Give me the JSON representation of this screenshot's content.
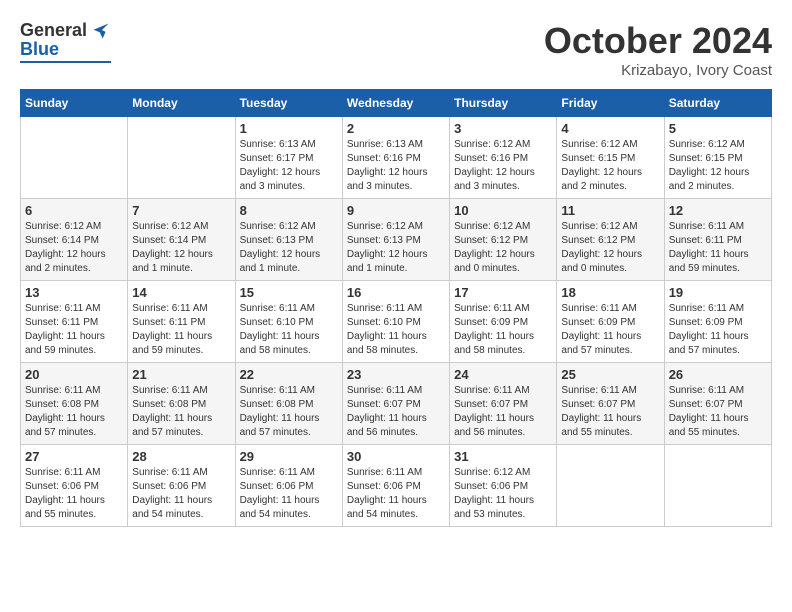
{
  "header": {
    "logo_general": "General",
    "logo_blue": "Blue",
    "month_title": "October 2024",
    "location": "Krizabayo, Ivory Coast"
  },
  "days_of_week": [
    "Sunday",
    "Monday",
    "Tuesday",
    "Wednesday",
    "Thursday",
    "Friday",
    "Saturday"
  ],
  "weeks": [
    [
      {
        "day": "",
        "info": ""
      },
      {
        "day": "",
        "info": ""
      },
      {
        "day": "1",
        "info": "Sunrise: 6:13 AM\nSunset: 6:17 PM\nDaylight: 12 hours and 3 minutes."
      },
      {
        "day": "2",
        "info": "Sunrise: 6:13 AM\nSunset: 6:16 PM\nDaylight: 12 hours and 3 minutes."
      },
      {
        "day": "3",
        "info": "Sunrise: 6:12 AM\nSunset: 6:16 PM\nDaylight: 12 hours and 3 minutes."
      },
      {
        "day": "4",
        "info": "Sunrise: 6:12 AM\nSunset: 6:15 PM\nDaylight: 12 hours and 2 minutes."
      },
      {
        "day": "5",
        "info": "Sunrise: 6:12 AM\nSunset: 6:15 PM\nDaylight: 12 hours and 2 minutes."
      }
    ],
    [
      {
        "day": "6",
        "info": "Sunrise: 6:12 AM\nSunset: 6:14 PM\nDaylight: 12 hours and 2 minutes."
      },
      {
        "day": "7",
        "info": "Sunrise: 6:12 AM\nSunset: 6:14 PM\nDaylight: 12 hours and 1 minute."
      },
      {
        "day": "8",
        "info": "Sunrise: 6:12 AM\nSunset: 6:13 PM\nDaylight: 12 hours and 1 minute."
      },
      {
        "day": "9",
        "info": "Sunrise: 6:12 AM\nSunset: 6:13 PM\nDaylight: 12 hours and 1 minute."
      },
      {
        "day": "10",
        "info": "Sunrise: 6:12 AM\nSunset: 6:12 PM\nDaylight: 12 hours and 0 minutes."
      },
      {
        "day": "11",
        "info": "Sunrise: 6:12 AM\nSunset: 6:12 PM\nDaylight: 12 hours and 0 minutes."
      },
      {
        "day": "12",
        "info": "Sunrise: 6:11 AM\nSunset: 6:11 PM\nDaylight: 11 hours and 59 minutes."
      }
    ],
    [
      {
        "day": "13",
        "info": "Sunrise: 6:11 AM\nSunset: 6:11 PM\nDaylight: 11 hours and 59 minutes."
      },
      {
        "day": "14",
        "info": "Sunrise: 6:11 AM\nSunset: 6:11 PM\nDaylight: 11 hours and 59 minutes."
      },
      {
        "day": "15",
        "info": "Sunrise: 6:11 AM\nSunset: 6:10 PM\nDaylight: 11 hours and 58 minutes."
      },
      {
        "day": "16",
        "info": "Sunrise: 6:11 AM\nSunset: 6:10 PM\nDaylight: 11 hours and 58 minutes."
      },
      {
        "day": "17",
        "info": "Sunrise: 6:11 AM\nSunset: 6:09 PM\nDaylight: 11 hours and 58 minutes."
      },
      {
        "day": "18",
        "info": "Sunrise: 6:11 AM\nSunset: 6:09 PM\nDaylight: 11 hours and 57 minutes."
      },
      {
        "day": "19",
        "info": "Sunrise: 6:11 AM\nSunset: 6:09 PM\nDaylight: 11 hours and 57 minutes."
      }
    ],
    [
      {
        "day": "20",
        "info": "Sunrise: 6:11 AM\nSunset: 6:08 PM\nDaylight: 11 hours and 57 minutes."
      },
      {
        "day": "21",
        "info": "Sunrise: 6:11 AM\nSunset: 6:08 PM\nDaylight: 11 hours and 57 minutes."
      },
      {
        "day": "22",
        "info": "Sunrise: 6:11 AM\nSunset: 6:08 PM\nDaylight: 11 hours and 57 minutes."
      },
      {
        "day": "23",
        "info": "Sunrise: 6:11 AM\nSunset: 6:07 PM\nDaylight: 11 hours and 56 minutes."
      },
      {
        "day": "24",
        "info": "Sunrise: 6:11 AM\nSunset: 6:07 PM\nDaylight: 11 hours and 56 minutes."
      },
      {
        "day": "25",
        "info": "Sunrise: 6:11 AM\nSunset: 6:07 PM\nDaylight: 11 hours and 55 minutes."
      },
      {
        "day": "26",
        "info": "Sunrise: 6:11 AM\nSunset: 6:07 PM\nDaylight: 11 hours and 55 minutes."
      }
    ],
    [
      {
        "day": "27",
        "info": "Sunrise: 6:11 AM\nSunset: 6:06 PM\nDaylight: 11 hours and 55 minutes."
      },
      {
        "day": "28",
        "info": "Sunrise: 6:11 AM\nSunset: 6:06 PM\nDaylight: 11 hours and 54 minutes."
      },
      {
        "day": "29",
        "info": "Sunrise: 6:11 AM\nSunset: 6:06 PM\nDaylight: 11 hours and 54 minutes."
      },
      {
        "day": "30",
        "info": "Sunrise: 6:11 AM\nSunset: 6:06 PM\nDaylight: 11 hours and 54 minutes."
      },
      {
        "day": "31",
        "info": "Sunrise: 6:12 AM\nSunset: 6:06 PM\nDaylight: 11 hours and 53 minutes."
      },
      {
        "day": "",
        "info": ""
      },
      {
        "day": "",
        "info": ""
      }
    ]
  ]
}
